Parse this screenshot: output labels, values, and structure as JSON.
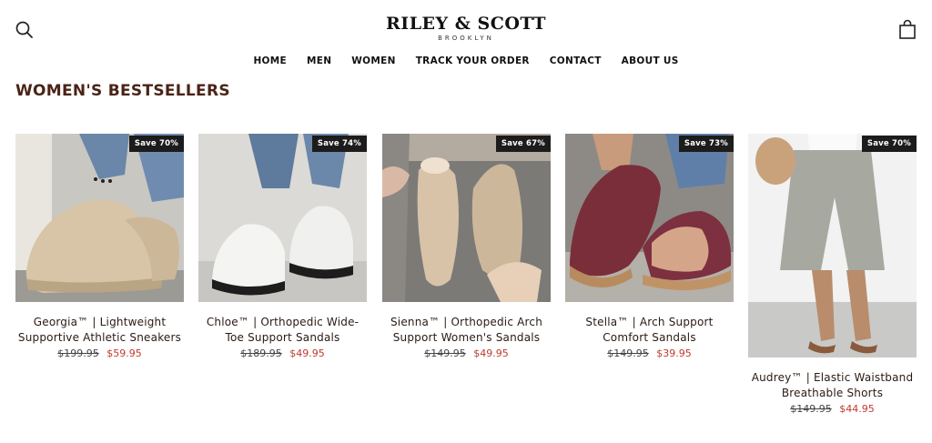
{
  "header": {
    "brand_name": "RILEY & SCOTT",
    "brand_sub": "BROOKLYN",
    "search_icon": "search-icon",
    "cart_icon": "shopping-bag-icon"
  },
  "nav": {
    "items": [
      "HOME",
      "MEN",
      "WOMEN",
      "TRACK YOUR ORDER",
      "CONTACT",
      "ABOUT US"
    ]
  },
  "section": {
    "title": "WOMEN'S BESTSELLERS"
  },
  "products": [
    {
      "badge": "Save 70%",
      "title": "Georgia™ | Lightweight Supportive Athletic Sneakers",
      "old_price": "$199.95",
      "new_price": "$59.95"
    },
    {
      "badge": "Save 74%",
      "title": "Chloe™ | Orthopedic Wide-Toe Support Sandals",
      "old_price": "$189.95",
      "new_price": "$49.95"
    },
    {
      "badge": "Save 67%",
      "title": "Sienna™ | Orthopedic Arch Support Women's Sandals",
      "old_price": "$149.95",
      "new_price": "$49.95"
    },
    {
      "badge": "Save 73%",
      "title": "Stella™ | Arch Support Comfort Sandals",
      "old_price": "$149.95",
      "new_price": "$39.95"
    },
    {
      "badge": "Save 70%",
      "title": "Audrey™ | Elastic Waistband Breathable Shorts",
      "old_price": "$149.95",
      "new_price": "$44.95"
    }
  ],
  "colors": {
    "accent_title": "#4a2418",
    "sale_price": "#c0392b",
    "badge_bg": "#1c1c1c"
  }
}
